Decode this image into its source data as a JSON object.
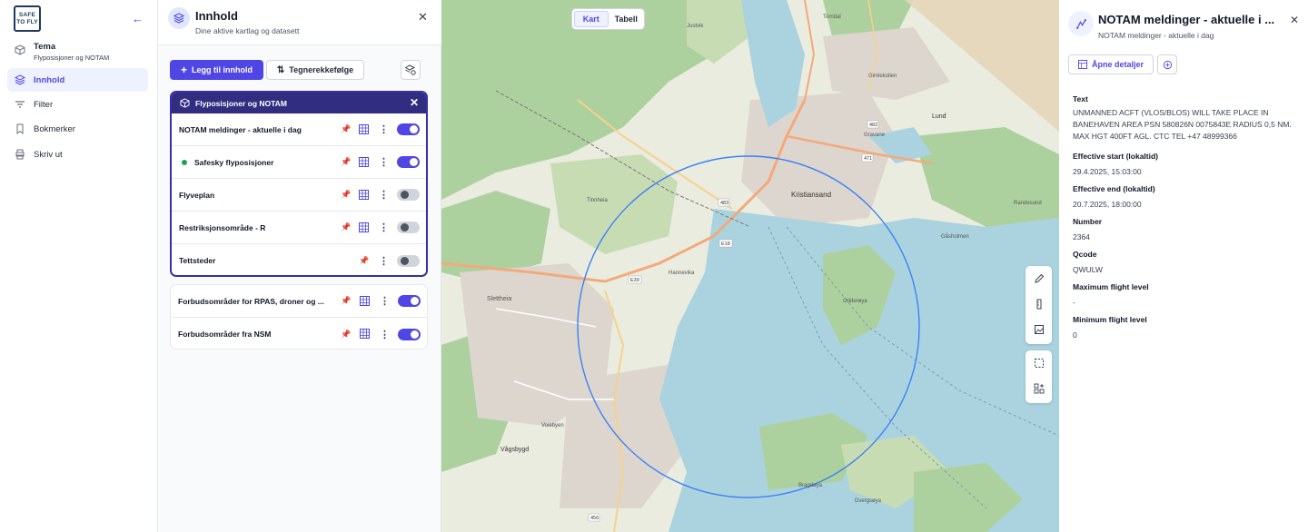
{
  "app": {
    "logo_line1": "SAFE",
    "logo_line2": "TO FLY"
  },
  "nav": {
    "tema_title": "Tema",
    "tema_sub": "Flyposisjoner og NOTAM",
    "items": [
      {
        "label": "Innhold",
        "icon": "layers-icon"
      },
      {
        "label": "Filter",
        "icon": "filter-icon"
      },
      {
        "label": "Bokmerker",
        "icon": "bookmark-icon"
      },
      {
        "label": "Skriv ut",
        "icon": "printer-icon"
      }
    ]
  },
  "panel": {
    "title": "Innhold",
    "subtitle": "Dine aktive kartlag og datasett",
    "add_label": "Legg til innhold",
    "order_label": "Tegnerekkefølge",
    "group_title": "Flyposisjoner og NOTAM",
    "layers": [
      {
        "label": "NOTAM meldinger - aktuelle i dag",
        "on": true
      },
      {
        "label": "Safesky flyposisjoner",
        "on": true
      },
      {
        "label": "Flyveplan",
        "on": false
      },
      {
        "label": "Restriksjonsområde - R",
        "on": false
      },
      {
        "label": "Tettsteder",
        "on": false
      }
    ],
    "other_layers": [
      {
        "label": "Forbudsområder for RPAS, droner og ...",
        "on": true
      },
      {
        "label": "Forbudsområder fra NSM",
        "on": true
      }
    ]
  },
  "map": {
    "view_tabs": [
      "Kart",
      "Tabell"
    ],
    "active_view": "Kart",
    "labels": [
      "Kristiansand",
      "Lund",
      "Vågsbygd",
      "Slettheia",
      "Odderøya",
      "Bragdøya",
      "Dvergsøya",
      "Gimlekollen",
      "Gravane",
      "Torridal",
      "Tinnheia",
      "Justvik",
      "Hannevika",
      "Voiebyen",
      "Randesund",
      "Gåsholmen"
    ],
    "roads": [
      "E18",
      "E39",
      "471",
      "483",
      "456",
      "482"
    ],
    "colors": {
      "water": "#aad3df",
      "land": "#e9ecdf",
      "forest": "#add19e",
      "circle": "#3b82f6"
    }
  },
  "detail": {
    "title": "NOTAM meldinger - aktuelle i ...",
    "subtitle": "NOTAM meldinger - aktuelle i dag",
    "open_label": "Åpne detaljer",
    "fields": [
      {
        "label": "Text",
        "value": "UNMANNED ACFT (VLOS/BLOS) WILL TAKE PLACE IN BANEHAVEN AREA PSN 580826N 0075843E RADIUS 0,5 NM. MAX HGT 400FT AGL. CTC TEL +47 48999366"
      },
      {
        "label": "Effective start (lokaltid)",
        "value": "29.4.2025, 15:03:00"
      },
      {
        "label": "Effective end (lokaltid)",
        "value": "20.7.2025, 18:00:00"
      },
      {
        "label": "Number",
        "value": "2364"
      },
      {
        "label": "Qcode",
        "value": "QWULW"
      },
      {
        "label": "Maximum flight level",
        "value": "-"
      },
      {
        "label": "Minimum flight level",
        "value": "0"
      }
    ]
  }
}
